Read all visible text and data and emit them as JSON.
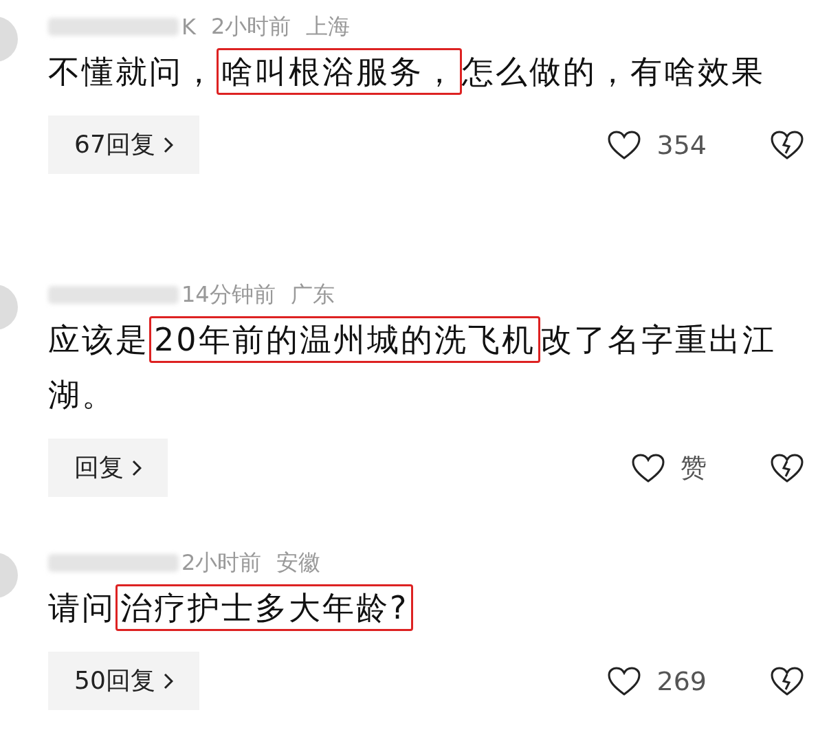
{
  "comments": [
    {
      "name_tail": "K",
      "time": "2小时前",
      "location": "上海",
      "segments": [
        {
          "text": "不懂就问，",
          "highlighted": false
        },
        {
          "text": "啥叫根浴服务，",
          "highlighted": true
        },
        {
          "text": "怎么做的，有啥效果",
          "highlighted": false
        }
      ],
      "reply_label": "67回复",
      "like_label": "354",
      "liked": false
    },
    {
      "time": "14分钟前",
      "location": "广东",
      "segments": [
        {
          "text": "应该是",
          "highlighted": false
        },
        {
          "text": "20年前的温州城的洗飞机",
          "highlighted": true
        },
        {
          "text": "改了名字重出江湖。",
          "highlighted": false
        }
      ],
      "reply_label": "回复",
      "like_label": "赞",
      "liked": false
    },
    {
      "time": "2小时前",
      "location": "安徽",
      "segments": [
        {
          "text": "请问",
          "highlighted": false
        },
        {
          "text": "治疗护士多大年龄?",
          "highlighted": true
        }
      ],
      "reply_label": "50回复",
      "like_label": "269",
      "liked": false
    }
  ]
}
